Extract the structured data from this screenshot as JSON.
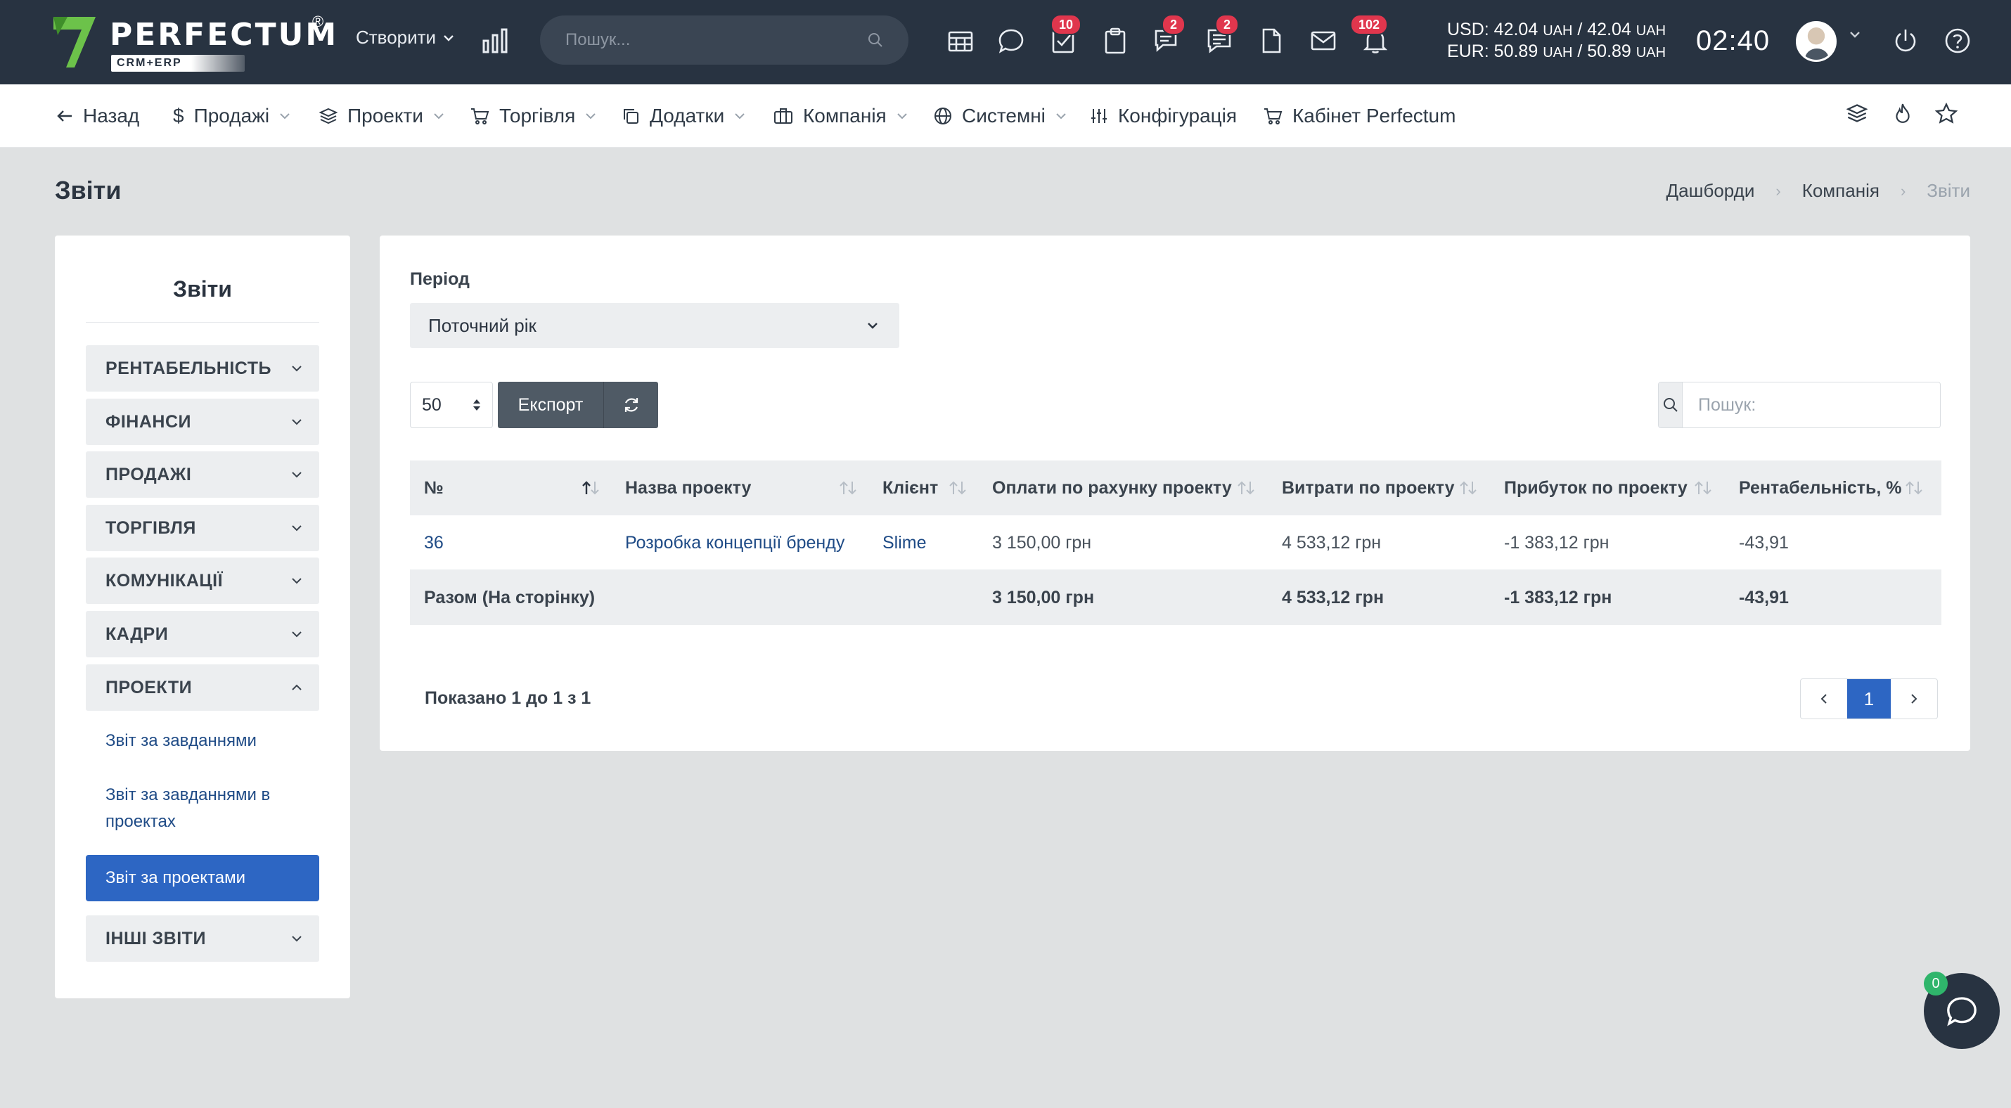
{
  "brand": {
    "name": "PERFECTUM",
    "reg": "®",
    "sub": "CRM+ERP"
  },
  "topbar": {
    "create_label": "Створити",
    "search_placeholder": "Пошук...",
    "badges": {
      "tasks": "10",
      "chat": "2",
      "messages": "2",
      "notifications": "102"
    },
    "rates": {
      "usd": "USD: 42.04",
      "usd_unit1": "UAH",
      "usd_mid": " / 42.04",
      "usd_unit2": "UAH",
      "eur": "EUR: 50.89",
      "eur_unit1": "UAH",
      "eur_mid": " / 50.89",
      "eur_unit2": "UAH"
    },
    "clock": "02:40"
  },
  "nav": {
    "back": "Назад",
    "sales": "Продажі",
    "projects": "Проекти",
    "trade": "Торгівля",
    "addons": "Додатки",
    "company": "Компанія",
    "system": "Системні",
    "config": "Конфігурація",
    "cabinet": "Кабінет Perfectum"
  },
  "page": {
    "title": "Звіти",
    "breadcrumb": [
      "Дашборди",
      "Компанія",
      "Звіти"
    ]
  },
  "sidebar": {
    "title": "Звіти",
    "items": [
      {
        "label": "РЕНТАБЕЛЬНІСТЬ"
      },
      {
        "label": "ФІНАНСИ"
      },
      {
        "label": "ПРОДАЖІ"
      },
      {
        "label": "ТОРГІВЛЯ"
      },
      {
        "label": "КОМУНІКАЦІЇ"
      },
      {
        "label": "КАДРИ"
      },
      {
        "label": "ПРОЕКТИ"
      },
      {
        "label": "ІНШІ ЗВІТИ"
      }
    ],
    "sub": [
      {
        "label": "Звіт за завданнями"
      },
      {
        "label": "Звіт за завданнями в проектах"
      },
      {
        "label": "Звіт за проектами"
      }
    ]
  },
  "report": {
    "period_label": "Період",
    "period_value": "Поточний рік",
    "page_size": "50",
    "export_label": "Експорт",
    "search_placeholder": "Пошук:",
    "columns": [
      "№",
      "Назва проекту",
      "Клієнт",
      "Оплати по рахунку проекту",
      "Витрати по проекту",
      "Прибуток по проекту",
      "Рентабельність, %"
    ],
    "rows": [
      {
        "num": "36",
        "name": "Розробка концепції бренду",
        "client": "Slime",
        "payments": "3 150,00 грн",
        "costs": "4 533,12 грн",
        "profit": "-1 383,12 грн",
        "margin": "-43,91"
      }
    ],
    "total": {
      "label": "Разом (На сторінку)",
      "payments": "3 150,00 грн",
      "costs": "4 533,12 грн",
      "profit": "-1 383,12 грн",
      "margin": "-43,91"
    },
    "showing": "Показано 1 до 1 з 1",
    "current_page": "1"
  },
  "chat": {
    "badge": "0"
  }
}
